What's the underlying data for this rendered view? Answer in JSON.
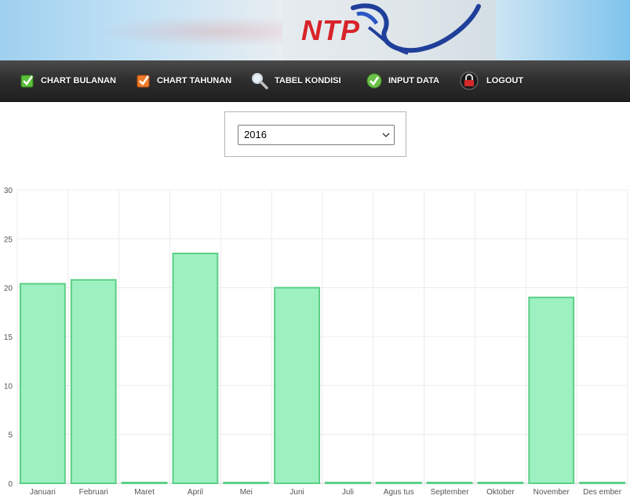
{
  "banner": {
    "logo_text": "NTP"
  },
  "nav": {
    "items": [
      {
        "label": "CHART BULANAN",
        "icon": "checkbox-green-icon"
      },
      {
        "label": "CHART TAHUNAN",
        "icon": "checkbox-orange-icon"
      },
      {
        "label": "TABEL KONDISI",
        "icon": "magnifier-icon"
      },
      {
        "label": "INPUT DATA",
        "icon": "check-circle-icon"
      },
      {
        "label": "LOGOUT",
        "icon": "padlock-icon"
      }
    ]
  },
  "filter": {
    "selected_year": "2016"
  },
  "colors": {
    "bar_fill": "#9df0bf",
    "bar_stroke": "#5ccf87",
    "nav_bg": "#2f2f2f"
  },
  "chart_data": {
    "type": "bar",
    "categories": [
      "Januari",
      "Februari",
      "Maret",
      "April",
      "Mei",
      "Juni",
      "Juli",
      "Agus tus",
      "September",
      "Oktober",
      "November",
      "Des ember"
    ],
    "values": [
      20.4,
      20.8,
      0,
      23.5,
      0,
      20,
      0,
      0,
      0,
      0,
      19,
      0
    ],
    "ylim": [
      0,
      30
    ],
    "yticks": [
      "0",
      "5",
      "10",
      "15",
      "20",
      "25",
      "30"
    ],
    "grid": true,
    "title": "",
    "xlabel": "",
    "ylabel": ""
  }
}
